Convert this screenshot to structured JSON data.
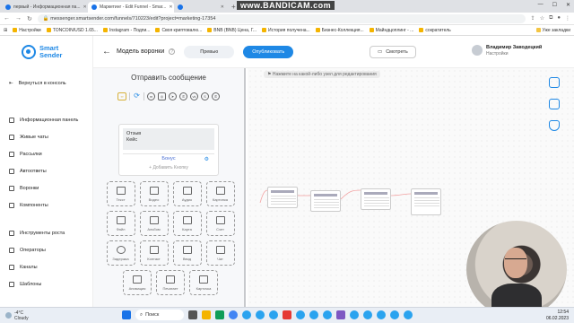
{
  "browser": {
    "tabs": [
      {
        "title": "первый - Информационная па...",
        "active": false
      },
      {
        "title": "Маркетинг - Edit Funnel - Smar...",
        "active": true
      },
      {
        "title": "",
        "active": false
      }
    ],
    "new_tab": "+",
    "recording_watermark": "www.BANDICAM.com",
    "url": "messenger.smartsender.com/funnels/710223/edit?project=marketing-17354",
    "bookmarks": [
      "Настройки",
      "TONCOIN/USD 1.65...",
      "Instagram - Подпи...",
      "Своя криптовалю...",
      "BNB (BNB) Цена, Г...",
      "История получена...",
      "Бизнес-Коллекция...",
      "Майндцоплинг - ...",
      "сократитель"
    ],
    "bookmarks_right": "Уже закладки"
  },
  "app": {
    "logo_line1": "Smart",
    "logo_line2": "Sender",
    "back_to_console": "Вернуться в консоль",
    "menu": [
      {
        "label": "Информационная панель",
        "icon": "dashboard-icon"
      },
      {
        "label": "Живые чаты",
        "icon": "chat-icon"
      },
      {
        "label": "Рассылки",
        "icon": "mail-icon"
      },
      {
        "label": "Автоответы",
        "icon": "reply-icon"
      },
      {
        "label": "Воронки",
        "icon": "funnel-icon"
      },
      {
        "label": "Компоненты",
        "icon": "components-icon"
      },
      {
        "label": "Инструменты роста",
        "icon": "growth-icon"
      },
      {
        "label": "Операторы",
        "icon": "operators-icon"
      },
      {
        "label": "Каналы",
        "icon": "channels-icon"
      },
      {
        "label": "Шаблоны",
        "icon": "templates-icon"
      }
    ]
  },
  "header": {
    "title": "Модель воронки",
    "preview": "Превью",
    "publish": "Опубликовать",
    "watch": "Смотреть",
    "user_name": "Владимир Заводецкий",
    "user_sub": "Настройки"
  },
  "panel": {
    "title": "Отправить сообщение",
    "message_line1": "Отзыв",
    "message_line2": "Кейс",
    "button_label": "Бонус",
    "add_button": "+ Добавить Кнопку",
    "blocks": [
      [
        "Текст",
        "Видео",
        "Аудио",
        "Картинка"
      ],
      [
        "Файл",
        "Альбом",
        "Карта",
        "Счет"
      ],
      [
        "Задержка",
        "Контакт",
        "Ввод",
        "Чат"
      ],
      [
        "Анимация",
        "Печатает",
        "Карточка"
      ]
    ]
  },
  "canvas": {
    "hint": "Нажмите на какой-либо узел для редактирования"
  },
  "taskbar": {
    "temp": "-4°C",
    "weather": "Cloudy",
    "search": "Поиск",
    "time": "12:54",
    "date": "06.02.2023"
  }
}
